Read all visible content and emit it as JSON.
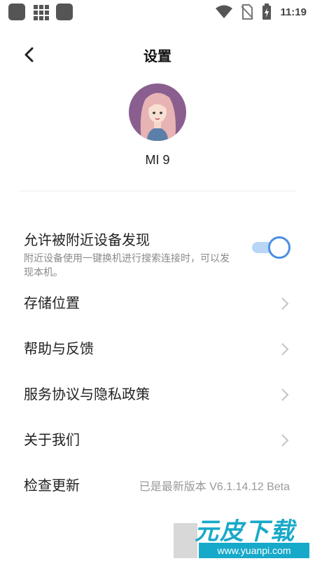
{
  "status_bar": {
    "time": "11:19",
    "icons": [
      "app-square-icon",
      "grid-icon",
      "app-square-icon",
      "wifi-icon",
      "no-sim-icon",
      "battery-charging-icon"
    ]
  },
  "header": {
    "title": "设置",
    "back_icon": "chevron-left-icon"
  },
  "profile": {
    "avatar_colors": {
      "bg": "#8a5f8f",
      "hair": "#e7b3b4"
    },
    "device_name": "MI 9"
  },
  "settings": {
    "discoverable": {
      "title": "允许被附近设备发现",
      "description": "附近设备使用一键换机进行搜索连接时，可以发现本机。",
      "enabled": true
    },
    "items": [
      {
        "label": "存储位置",
        "icon": "chevron-right-icon"
      },
      {
        "label": "帮助与反馈",
        "icon": "chevron-right-icon"
      },
      {
        "label": "服务协议与隐私政策",
        "icon": "chevron-right-icon"
      },
      {
        "label": "关于我们",
        "icon": "chevron-right-icon"
      }
    ],
    "update": {
      "label": "检查更新",
      "value": "已是最新版本 V6.1.14.12 Beta"
    }
  },
  "colors": {
    "accent": "#4a8fe3",
    "accent_light": "#b9d6f6",
    "text_primary": "#222222",
    "text_secondary": "#8a8a8a"
  },
  "watermark": {
    "title": "元皮下载",
    "url": "www.yuanpi.com"
  }
}
